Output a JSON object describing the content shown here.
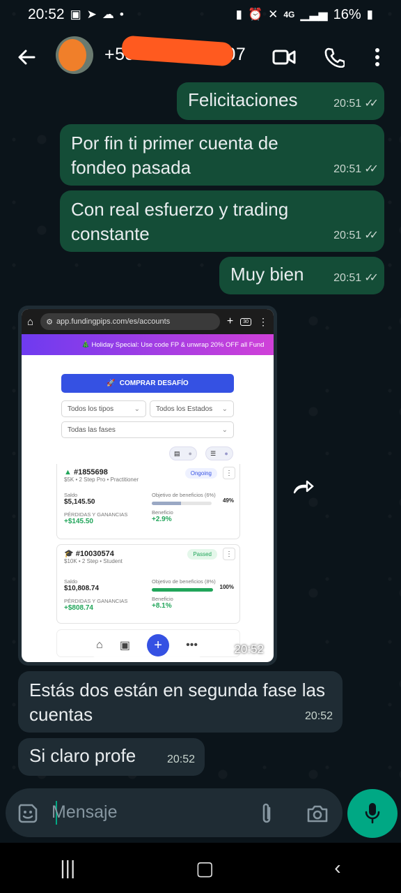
{
  "status_bar": {
    "time": "20:52",
    "network": "4G",
    "battery": "16%"
  },
  "header": {
    "contact": "+55 35 99 4 5107"
  },
  "messages": [
    {
      "text": "Felicitaciones",
      "time": "20:51"
    },
    {
      "text": "Por fin ti primer cuenta de fondeo pasada",
      "time": "20:51"
    },
    {
      "text": "Con real esfuerzo y trading constante",
      "time": "20:51"
    },
    {
      "text": "Muy bien",
      "time": "20:51"
    },
    {
      "text": "Estás dos están en segunda fase las cuentas",
      "time": "20:52"
    },
    {
      "text": "Si claro profe",
      "time": "20:52"
    }
  ],
  "image_message": {
    "time": "20:52",
    "url": "app.fundingpips.com/es/accounts",
    "promo": "🎄 Holiday Special: Use code FP & unwrap 20% OFF all Fund",
    "buy_button": "COMPRAR DESAFÍO",
    "filters": {
      "types": "Todos los tipos",
      "states": "Todos los Estados",
      "phases": "Todas las fases"
    },
    "accounts": [
      {
        "id": "#1855698",
        "meta": "$5K  •  2 Step Pro  •  Practitioner",
        "status": "Ongoing",
        "saldo_label": "Saldo",
        "saldo": "$5,145.50",
        "objetivo_label": "Objetivo de beneficios (6%)",
        "objetivo_pct": "49%",
        "progress": 0.49,
        "pg_label": "PÉRDIDAS Y GANANCIAS",
        "pg": "+$145.50",
        "beneficio_label": "Beneficio",
        "beneficio": "+2.9%"
      },
      {
        "id": "#10030574",
        "meta": "$10K  •  2 Step  •  Student",
        "status": "Passed",
        "saldo_label": "Saldo",
        "saldo": "$10,808.74",
        "objetivo_label": "Objetivo de beneficios (8%)",
        "objetivo_pct": "100%",
        "progress": 1.0,
        "pg_label": "PÉRDIDAS Y GANANCIAS",
        "pg": "+$808.74",
        "beneficio_label": "Beneficio",
        "beneficio": "+8.1%"
      }
    ]
  },
  "composer": {
    "placeholder": "Mensaje"
  },
  "colors": {
    "outgoing": "#144d37",
    "incoming": "#1f2c34",
    "accent": "#00a884",
    "fab": "#3551e3"
  }
}
